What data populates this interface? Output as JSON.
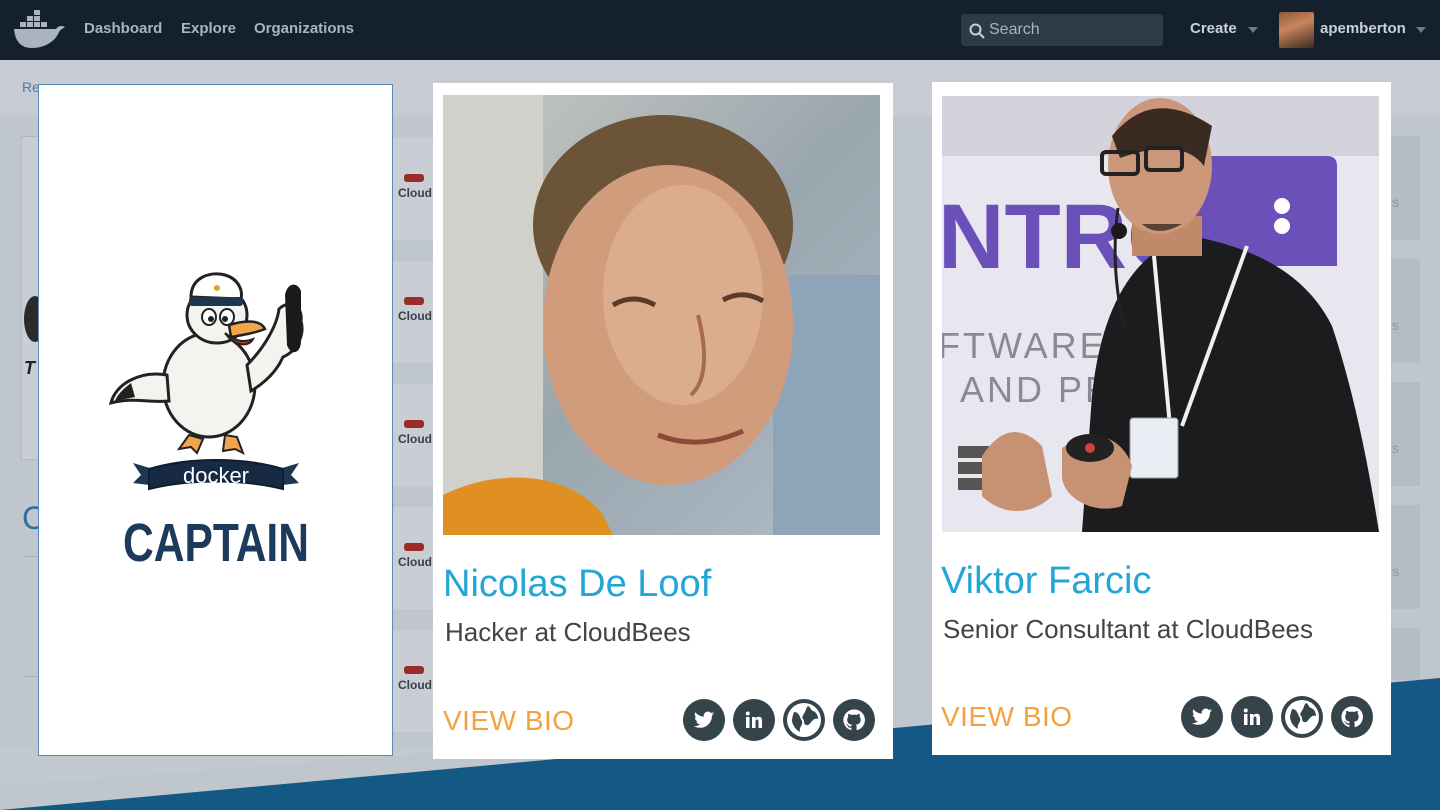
{
  "nav": {
    "links": [
      "Dashboard",
      "Explore",
      "Organizations"
    ],
    "search_placeholder": "Search",
    "create_label": "Create",
    "username": "apemberton"
  },
  "background": {
    "breadcrumb_fragment": "Re",
    "letter_t": "T",
    "letter_c": "C",
    "partner_fragment": "Cloud",
    "right_fragment": "s"
  },
  "captain_card": {
    "badge_top": "docker",
    "badge_bottom": "CAPTAIN"
  },
  "people": [
    {
      "name": "Nicolas De Loof",
      "role": "Hacker at CloudBees",
      "bio_label": "VIEW BIO",
      "socials": [
        "twitter-icon",
        "linkedin-icon",
        "globe-icon",
        "github-icon"
      ]
    },
    {
      "name": "Viktor Farcic",
      "role": "Senior Consultant at CloudBees",
      "bio_label": "VIEW BIO",
      "socials": [
        "twitter-icon",
        "linkedin-icon",
        "globe-icon",
        "github-icon"
      ],
      "backdrop_text": [
        "NTRO",
        "FTWARE",
        "AND PR"
      ]
    }
  ],
  "colors": {
    "nav_bg": "#14202c",
    "name": "#23a6d5",
    "bio": "#f4a240",
    "social_bg": "#35434b",
    "footer": "#145985"
  }
}
